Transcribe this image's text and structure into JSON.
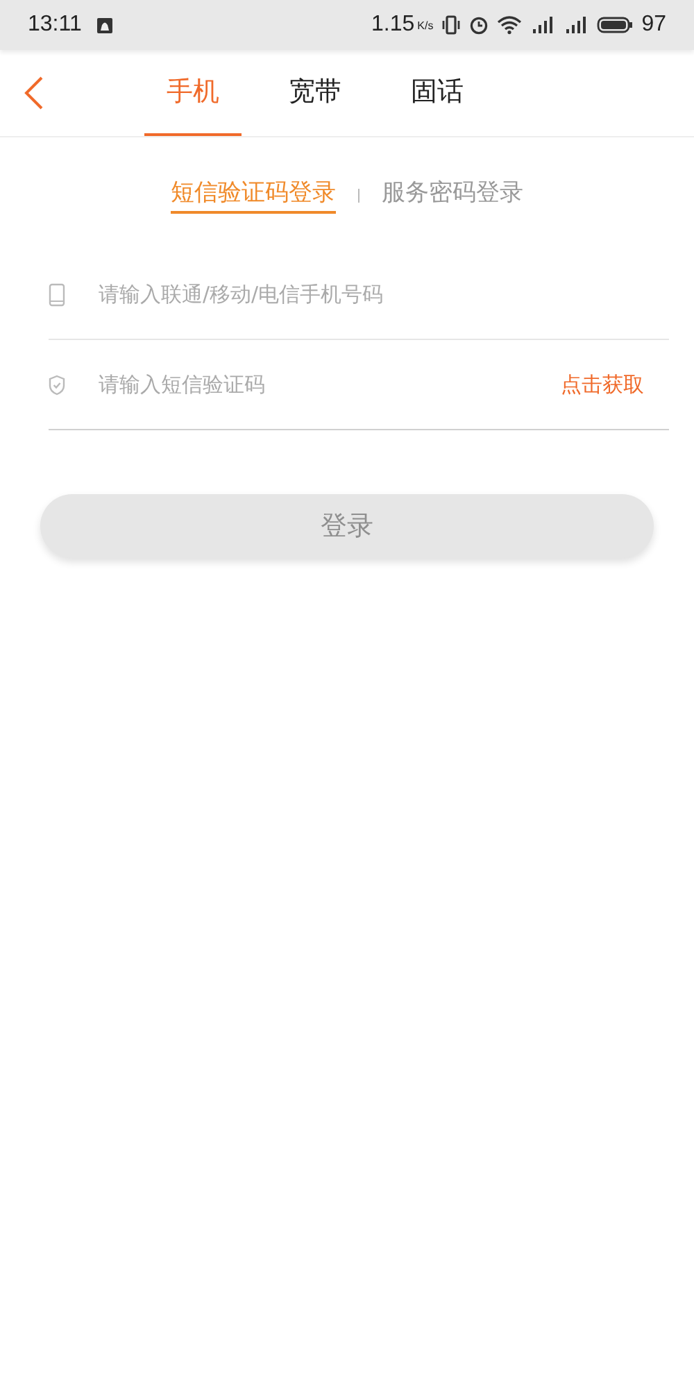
{
  "status_bar": {
    "time": "13:11",
    "speed": "1.15",
    "speed_unit": "K/s",
    "battery": "97"
  },
  "tabs": [
    {
      "label": "手机",
      "selected": true
    },
    {
      "label": "宽带",
      "selected": false
    },
    {
      "label": "固话",
      "selected": false
    }
  ],
  "login_modes": [
    {
      "label": "短信验证码登录",
      "selected": true
    },
    {
      "label": "服务密码登录",
      "selected": false
    }
  ],
  "fields": [
    {
      "kind": "phone",
      "placeholder": "请输入联通/移动/电信手机号码"
    },
    {
      "kind": "code",
      "placeholder": "请输入短信验证码",
      "action": "点击获取"
    }
  ],
  "login_button": {
    "label": "登录",
    "disabled": true
  }
}
